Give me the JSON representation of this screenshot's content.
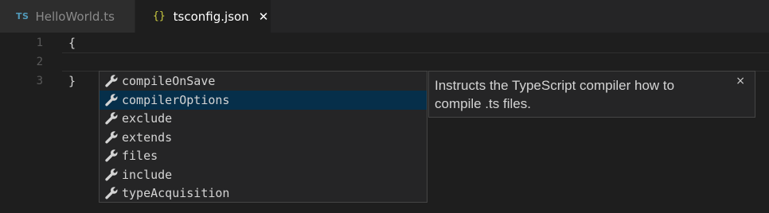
{
  "tabs": [
    {
      "icon": "TS",
      "label": "HelloWorld.ts",
      "active": false
    },
    {
      "icon": "{}",
      "label": "tsconfig.json",
      "active": true,
      "close": "✕"
    }
  ],
  "editor": {
    "lines": [
      {
        "number": "1",
        "text": "{"
      },
      {
        "number": "2",
        "text": ""
      },
      {
        "number": "3",
        "text": "}"
      }
    ]
  },
  "suggest": {
    "items": [
      {
        "label": "compileOnSave",
        "icon": "wrench-icon"
      },
      {
        "label": "compilerOptions",
        "icon": "wrench-icon",
        "selected": true
      },
      {
        "label": "exclude",
        "icon": "wrench-icon"
      },
      {
        "label": "extends",
        "icon": "wrench-icon"
      },
      {
        "label": "files",
        "icon": "wrench-icon"
      },
      {
        "label": "include",
        "icon": "wrench-icon"
      },
      {
        "label": "typeAcquisition",
        "icon": "wrench-icon"
      }
    ],
    "details": {
      "text": "Instructs the TypeScript compiler how to compile .ts files.",
      "close": "×"
    }
  },
  "colors": {
    "background": "#1e1e1e",
    "selection": "#062f4a",
    "ts_icon": "#519aba",
    "json_icon": "#cbcb41"
  }
}
